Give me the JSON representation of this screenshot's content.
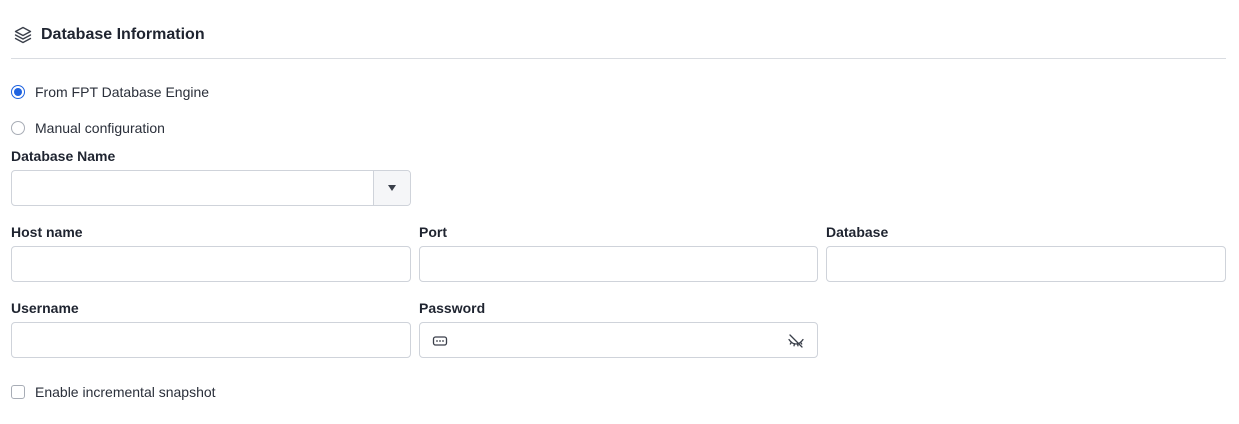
{
  "section": {
    "title": "Database Information",
    "icon": "layers-icon"
  },
  "source_options": [
    {
      "label": "From FPT Database Engine",
      "selected": true
    },
    {
      "label": "Manual configuration",
      "selected": false
    }
  ],
  "database_name": {
    "label": "Database Name",
    "value": "",
    "placeholder": ""
  },
  "fields": {
    "host_name": {
      "label": "Host name",
      "value": "",
      "placeholder": ""
    },
    "port": {
      "label": "Port",
      "value": "",
      "placeholder": ""
    },
    "database": {
      "label": "Database",
      "value": "",
      "placeholder": ""
    },
    "username": {
      "label": "Username",
      "value": "",
      "placeholder": ""
    },
    "password": {
      "label": "Password",
      "value": "",
      "placeholder": ""
    }
  },
  "incremental_snapshot": {
    "label": "Enable incremental snapshot",
    "checked": false
  },
  "colors": {
    "accent": "#1f63e0",
    "border": "#cfd3da",
    "text": "#1f2430"
  }
}
